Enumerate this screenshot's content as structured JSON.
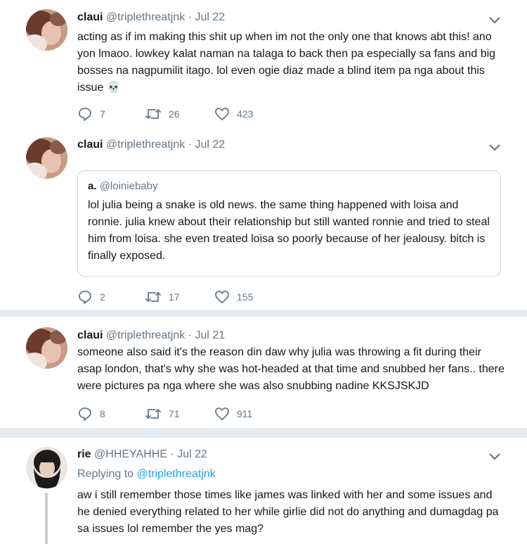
{
  "tweets": [
    {
      "name": "claui",
      "handle": "@triplethreatjnk",
      "date": "· Jul 22",
      "text": "acting as if im making this shit up when im not the only one that knows abt this! ano yon lmaoo. lowkey kalat naman na talaga to back then pa especially sa fans and big bosses  na nagpumilit itago. lol even ogie diaz made a blind item pa nga about this issue 💀",
      "replies": "7",
      "retweets": "26",
      "likes": "423"
    },
    {
      "name": "claui",
      "handle": "@triplethreatjnk",
      "date": "· Jul 22",
      "quote": {
        "name": "a.",
        "handle": "@loiniebaby",
        "text": "lol julia being a snake is old news. the same thing happened with loisa and ronnie. julia knew about their relationship but still wanted ronnie and tried to steal him from loisa. she even treated loisa so poorly because of her jealousy. bitch is finally exposed."
      },
      "replies": "2",
      "retweets": "17",
      "likes": "155"
    },
    {
      "name": "claui",
      "handle": "@triplethreatjnk",
      "date": "· Jul 21",
      "text": "someone also said it's the reason din daw why julia was throwing a fit during their asap london, that's why she was hot-headed at that time and snubbed her fans.. there were pictures pa nga where she was also snubbing nadine KKSJSKJD",
      "replies": "8",
      "retweets": "71",
      "likes": "911"
    },
    {
      "name": "rie",
      "handle": "@HHEYAHHE",
      "date": "· Jul 22",
      "replying_label": "Replying to",
      "replying_handle": "@triplethreatjnk",
      "text": "aw i still remember those times like james was linked with her and some issues and he denied everything related to her while girlie did not do anything and dumagdag pa sa issues lol remember the yes mag?"
    }
  ],
  "icons": {
    "reply": "reply-icon",
    "retweet": "retweet-icon",
    "like": "heart-icon",
    "menu": "chevron-down-icon"
  },
  "colors": {
    "accent": "#1da1f2",
    "muted": "#657786",
    "thread_line": "#c4cfd6",
    "separator": "#e6ecf0"
  }
}
